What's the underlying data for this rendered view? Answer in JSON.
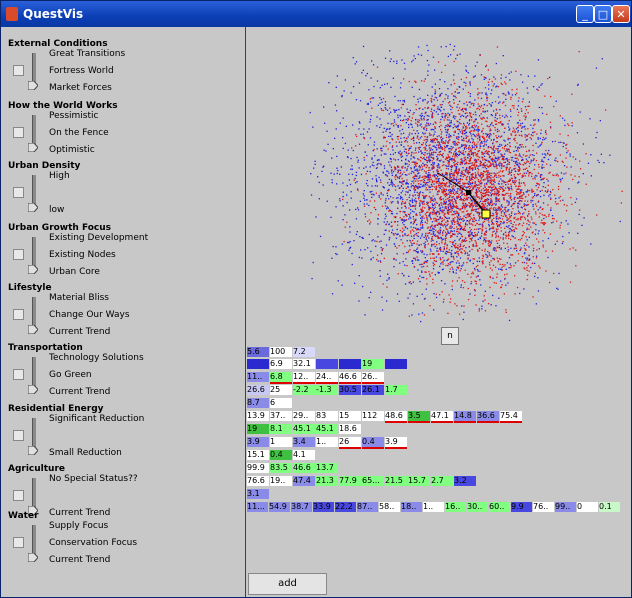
{
  "window": {
    "title": "QuestVis",
    "buttons": [
      "_",
      "□",
      "✕"
    ]
  },
  "sidebar": {
    "categories": [
      {
        "label": "External Conditions",
        "options": [
          "Great Transitions",
          "Fortress World",
          "Market Forces"
        ]
      },
      {
        "label": "How the World Works",
        "options": [
          "Pessimistic",
          "On the Fence",
          "Optimistic"
        ]
      },
      {
        "label": "Urban Density",
        "options": [
          "High",
          "",
          "low"
        ]
      },
      {
        "label": "Urban Growth Focus",
        "options": [
          "Existing Development",
          "Existing Nodes",
          "Urban Core"
        ]
      },
      {
        "label": "Lifestyle",
        "options": [
          "Material Bliss",
          "Change Our Ways",
          "Current Trend"
        ]
      },
      {
        "label": "Transportation",
        "options": [
          "Technology Solutions",
          "Go Green",
          "Current Trend"
        ]
      },
      {
        "label": "Residential Energy",
        "options": [
          "Significant Reduction",
          "",
          "Small Reduction"
        ]
      },
      {
        "label": "Agriculture",
        "options": [
          "No Special Status??",
          "",
          "Current Trend"
        ]
      },
      {
        "label": "Water",
        "options": [
          "Supply Focus",
          "Conservation Focus",
          "Current Trend"
        ]
      }
    ]
  },
  "main": {
    "reset_label": "n",
    "add_label": "add",
    "grid_rows": [
      [
        {
          "t": "5.6",
          "c": "#6a6adb"
        },
        {
          "t": "100",
          "c": "#ffffff"
        },
        {
          "t": "7.2",
          "c": "#d8d8f8"
        }
      ],
      [
        {
          "t": "",
          "c": "#2a2ad0"
        },
        {
          "t": "6.9",
          "c": "#ffffff"
        },
        {
          "t": "32.1",
          "c": "#ffffff"
        },
        {
          "t": "",
          "c": "#4848e0"
        },
        {
          "t": "",
          "c": "#2a2ad0"
        },
        {
          "t": "19",
          "c": "#80ff80"
        },
        {
          "t": "",
          "c": "#2a2ad0"
        }
      ],
      [
        {
          "t": "11..",
          "c": "#8a8ae8"
        },
        {
          "t": "6.8",
          "c": "#80ff80"
        },
        {
          "t": "12..",
          "c": "#ffffff"
        },
        {
          "t": "24..",
          "c": "#ffffff"
        },
        {
          "t": "46.6",
          "c": "#ffffff"
        },
        {
          "t": "26..",
          "c": "#ffffff"
        }
      ],
      [
        {
          "t": "26.6",
          "c": "#c8c8f4"
        },
        {
          "t": "25",
          "c": "#ffffff"
        },
        {
          "t": "-2.2",
          "c": "#80ff80"
        },
        {
          "t": "-1.3",
          "c": "#80ff80"
        },
        {
          "t": "30.5",
          "c": "#4848e0"
        },
        {
          "t": "26.1",
          "c": "#4848e0"
        },
        {
          "t": "1.7",
          "c": "#80ff80"
        }
      ],
      [
        {
          "t": "8.7",
          "c": "#8a8ae8"
        },
        {
          "t": "6",
          "c": "#ffffff"
        }
      ],
      [
        {
          "t": "13.9",
          "c": "#ffffff"
        },
        {
          "t": "37..",
          "c": "#ffffff"
        },
        {
          "t": "29..",
          "c": "#ffffff"
        },
        {
          "t": "83",
          "c": "#ffffff"
        },
        {
          "t": "15",
          "c": "#ffffff"
        },
        {
          "t": "112",
          "c": "#ffffff"
        },
        {
          "t": "48.6",
          "c": "#ffffff"
        },
        {
          "t": "3.5",
          "c": "#40c040"
        },
        {
          "t": "47.1",
          "c": "#ffffff"
        },
        {
          "t": "14.8",
          "c": "#8a8ae8"
        },
        {
          "t": "36.6",
          "c": "#8a8ae8"
        },
        {
          "t": "75.4",
          "c": "#ffffff"
        }
      ],
      [
        {
          "t": "19",
          "c": "#40c040"
        },
        {
          "t": "8.1",
          "c": "#80ff80"
        },
        {
          "t": "45.1",
          "c": "#80ff80"
        },
        {
          "t": "45.1",
          "c": "#80ff80"
        },
        {
          "t": "18.6",
          "c": "#ffffff"
        }
      ],
      [
        {
          "t": "3.9",
          "c": "#8a8ae8"
        },
        {
          "t": "1",
          "c": "#ffffff"
        },
        {
          "t": "3.4",
          "c": "#8a8ae8"
        },
        {
          "t": "1..",
          "c": "#ffffff"
        },
        {
          "t": "26",
          "c": "#ffffff"
        },
        {
          "t": "0.4",
          "c": "#8a8ae8"
        },
        {
          "t": "3.9",
          "c": "#ffffff"
        }
      ],
      [
        {
          "t": "15.1",
          "c": "#ffffff"
        },
        {
          "t": "0.4",
          "c": "#40c040"
        },
        {
          "t": "4.1",
          "c": "#ffffff"
        }
      ],
      [
        {
          "t": "99.9",
          "c": "#ffffff"
        },
        {
          "t": "83.5",
          "c": "#80ff80"
        },
        {
          "t": "46.6",
          "c": "#80ff80"
        },
        {
          "t": "13.7",
          "c": "#80ff80"
        }
      ],
      [
        {
          "t": "76.6",
          "c": "#ffffff"
        },
        {
          "t": "19..",
          "c": "#ffffff"
        },
        {
          "t": "47.4",
          "c": "#8a8ae8"
        },
        {
          "t": "21.3",
          "c": "#80ff80"
        },
        {
          "t": "77.9",
          "c": "#80ff80"
        },
        {
          "t": "65...",
          "c": "#80ff80"
        },
        {
          "t": "21.5",
          "c": "#80ff80"
        },
        {
          "t": "15.7",
          "c": "#80ff80"
        },
        {
          "t": "2.7",
          "c": "#80ff80"
        },
        {
          "t": "3.2",
          "c": "#4848e0"
        }
      ],
      [
        {
          "t": "3.1",
          "c": "#8a8ae8"
        }
      ],
      [
        {
          "t": "11...",
          "c": "#8a8ae8"
        },
        {
          "t": "54.9",
          "c": "#8a8ae8"
        },
        {
          "t": "38.7",
          "c": "#8a8ae8"
        },
        {
          "t": "33.9",
          "c": "#4848e0"
        },
        {
          "t": "22.2",
          "c": "#4848e0"
        },
        {
          "t": "87..",
          "c": "#8a8ae8"
        },
        {
          "t": "58..",
          "c": "#ffffff"
        },
        {
          "t": "18..",
          "c": "#8a8ae8"
        },
        {
          "t": "1..",
          "c": "#ffffff"
        },
        {
          "t": "16..",
          "c": "#80ff80"
        },
        {
          "t": "30..",
          "c": "#80ff80"
        },
        {
          "t": "60..",
          "c": "#80ff80"
        },
        {
          "t": "9.9",
          "c": "#4848e0"
        },
        {
          "t": "76..",
          "c": "#ffffff"
        },
        {
          "t": "99..",
          "c": "#8a8ae8"
        },
        {
          "t": "0",
          "c": "#ffffff"
        },
        {
          "t": "0.1",
          "c": "#c8f8c8"
        }
      ]
    ]
  },
  "colors": {
    "point_a": "#e01818",
    "point_b": "#2020e0",
    "marker": "#ffff40"
  }
}
